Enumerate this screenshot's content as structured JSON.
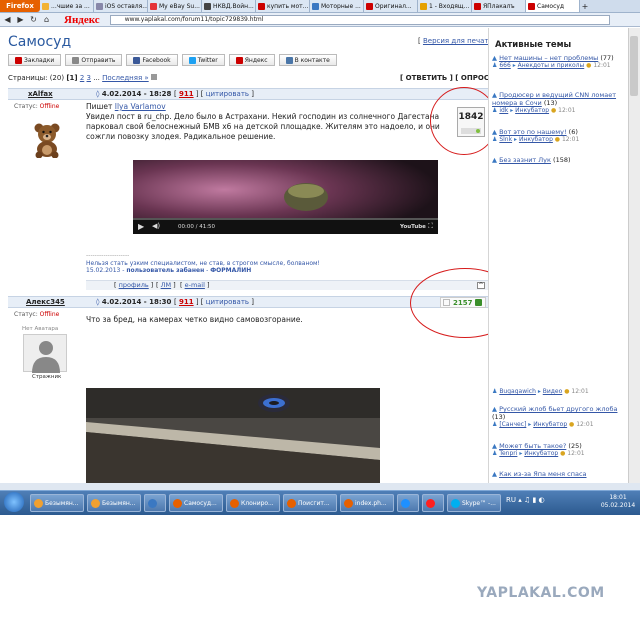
{
  "browser": {
    "app_button": "Firefox",
    "tabs": [
      {
        "label": "...чшие за ...",
        "color": "#f2b233"
      },
      {
        "label": "iOS оставля...",
        "color": "#8888aa"
      },
      {
        "label": "My eBay Su...",
        "color": "#e53238"
      },
      {
        "label": "НКВД.Войн...",
        "color": "#444444"
      },
      {
        "label": "купить мот...",
        "color": "#cc0000"
      },
      {
        "label": "Моторные ...",
        "color": "#3a78c2"
      },
      {
        "label": "Оригинал...",
        "color": "#cc0000"
      },
      {
        "label": "1 - Входящ...",
        "color": "#e5a100"
      },
      {
        "label": "ЯПлакалъ",
        "color": "#cc0000"
      },
      {
        "label": "Самосуд",
        "color": "#cc0000"
      }
    ],
    "new_tab": "+",
    "search_logo": "Яндекс",
    "url": "www.yaplakal.com/forum11/topic729839.html"
  },
  "topic": {
    "title": "Самосуд",
    "print_link": "Версия для печати",
    "share": [
      {
        "label": "Закладки",
        "icon": "bookmark-icon",
        "color": "#cc0000"
      },
      {
        "label": "Отправить",
        "icon": "mail-icon",
        "color": "#888888"
      },
      {
        "label": "Facebook",
        "icon": "facebook-icon",
        "color": "#3b5998"
      },
      {
        "label": "Twitter",
        "icon": "twitter-icon",
        "color": "#1da1f2"
      },
      {
        "label": "Яндекс",
        "icon": "yandex-icon",
        "color": "#cc0000"
      },
      {
        "label": "В контакте",
        "icon": "vk-icon",
        "color": "#4a76a8"
      }
    ],
    "pages_prefix": "Страницы: (20)",
    "pages_current": "[1]",
    "pages_links": [
      "2",
      "3"
    ],
    "pages_more": "...",
    "pages_last": "Последняя »",
    "reply": "[ ОТВЕТИТЬ ]",
    "poll": "[ ОПРОС ]"
  },
  "posts": [
    {
      "author": "xAlfax",
      "date": "4.02.2014 - 18:28",
      "number": "911",
      "quote": "цитировать",
      "status_label": "Статус:",
      "status_value": "Offline",
      "text_prefix": "Пишет ",
      "text_author": "Ilya Varlamov",
      "text": "Увидел пост в ru_chp. Дело было в Астрахани. Некий господин из солнечного Дагестана парковал свой белоснежный БМВ х6 на детской площадке. Жителям это надоело, и они сожгли повозку злодея. Радикальное решение.",
      "rating": "1842",
      "video_time": "00:00 / 41:50",
      "video_brand": "YouTube",
      "sig_line": "--------------------",
      "sig": "Нельзя стать узким специалистом, не став, в строгом смысле, болваном!",
      "ban_date": "15.02.2013 - ",
      "ban_text": "пользователь забанен",
      "ban_sep": " - ",
      "ban_reason": "ФОРМАЛИН",
      "foot": [
        "профиль",
        "ЛМ",
        "e-mail"
      ]
    },
    {
      "author": "Алекс345",
      "date": "4.02.2014 - 18:30",
      "number": "911",
      "quote": "цитировать",
      "status_label": "Статус:",
      "status_value": "Offline",
      "avatar_caption": "Нет Аватара",
      "rank": "Стражник",
      "text": "Что за бред, на камерах четко видно самовозгорание.",
      "rating": "2157"
    }
  ],
  "sidebar": {
    "title": "Активные темы",
    "topics": [
      {
        "title": "Нет машины – нет проблемы",
        "count": "(77)",
        "meta_user": "666",
        "meta_section": "Анекдоты и приколы",
        "time": "12:01"
      },
      {
        "title": "Продюсер и ведущий CNN ломает номера в Сочи",
        "count": "(13)",
        "meta_user": "idk",
        "meta_section": "Инкубатор",
        "time": "12:01"
      },
      {
        "title": "Вот это по нашему!",
        "count": "(6)",
        "meta_user": "Slnk",
        "meta_section": "Инкубатор",
        "time": "12:01"
      },
      {
        "title": "Без зазнит Лук",
        "count": "(158)",
        "meta_user": "",
        "meta_section": "",
        "time": ""
      }
    ],
    "bottom_topics": [
      {
        "title": "",
        "count": "",
        "meta_user": "Bugagawich",
        "meta_section": "Видео",
        "time": "12:01"
      },
      {
        "title": "Русский жлоб бьет другого жлоба",
        "count": "(13)",
        "meta_user": "[Cанчес]",
        "meta_section": "Инкубатор",
        "time": "12:01"
      },
      {
        "title": "Может быть такое?",
        "count": "(25)",
        "meta_user": "Tenpri",
        "meta_section": "Инкубатор",
        "time": "12:01"
      },
      {
        "title": "Как из-за Япа меня спаса",
        "count": "",
        "meta_user": "",
        "meta_section": "",
        "time": ""
      }
    ]
  },
  "taskbar": {
    "items": [
      {
        "label": "Безымян...",
        "color": "#f0a030"
      },
      {
        "label": "Безымян...",
        "color": "#f0a030"
      },
      {
        "label": "",
        "color": "#3a78c2"
      },
      {
        "label": "Самосуд...",
        "color": "#e66000"
      },
      {
        "label": "Клонирo...",
        "color": "#e66000"
      },
      {
        "label": "Поисгит...",
        "color": "#e66000"
      },
      {
        "label": "index.ph...",
        "color": "#e66000"
      },
      {
        "label": "",
        "color": "#1e90ff"
      },
      {
        "label": "",
        "color": "#ff2020"
      },
      {
        "label": "Skype™ -...",
        "color": "#00aff0"
      }
    ],
    "lang": "RU",
    "time": "18:01",
    "date": "05.02.2014"
  },
  "watermark": "YAPLAKAL.COM"
}
